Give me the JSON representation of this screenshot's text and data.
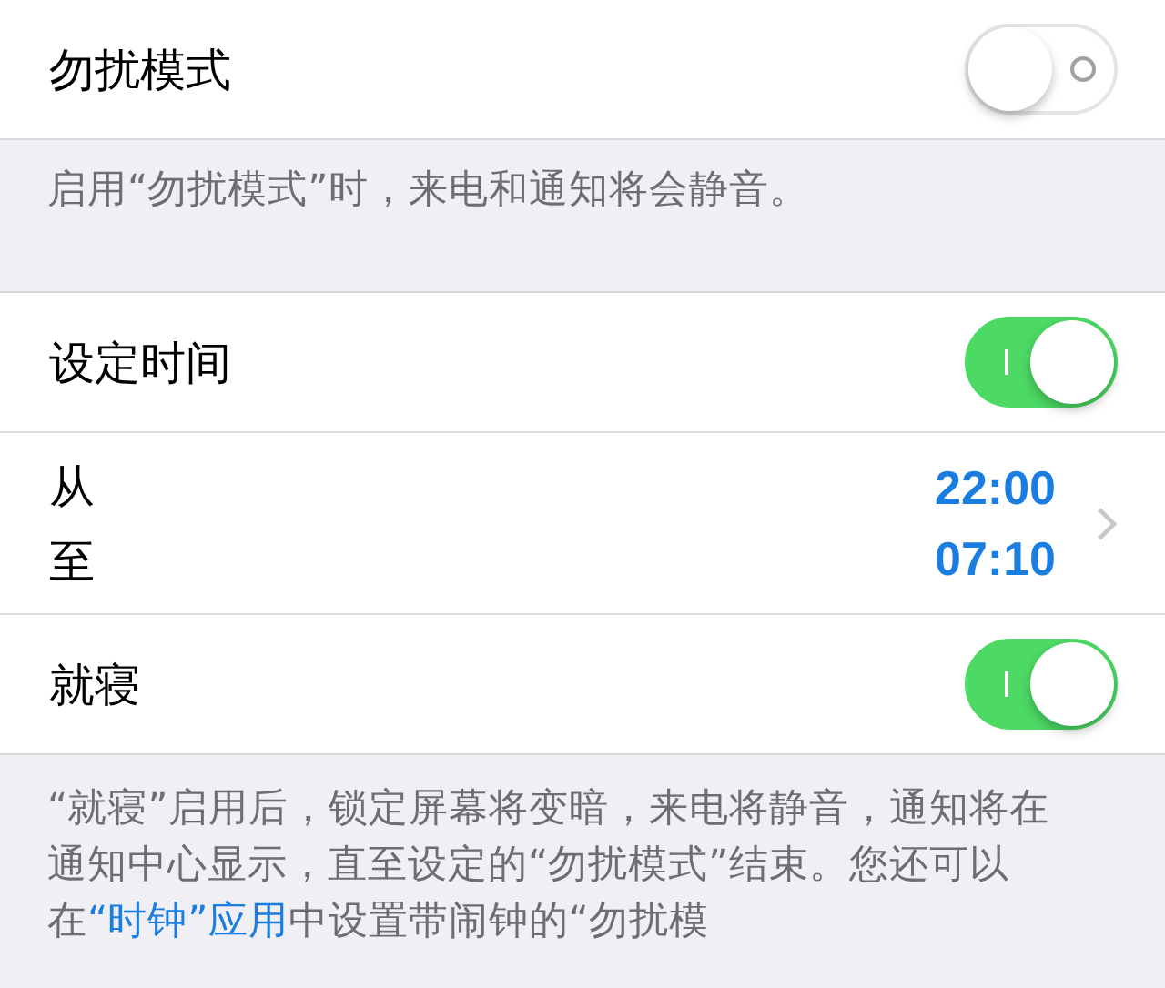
{
  "sections": [
    {
      "rows": [
        {
          "kind": "toggle",
          "label": "勿扰模式",
          "on": false
        }
      ],
      "footer": [
        {
          "kind": "text",
          "text": "启用“勿扰模式”时，来电和通知将会静音。"
        }
      ]
    },
    {
      "rows": [
        {
          "kind": "toggle",
          "label": "设定时间",
          "on": true
        },
        {
          "kind": "schedule",
          "from_label": "从",
          "to_label": "至",
          "from": "22:00",
          "to": "07:10"
        },
        {
          "kind": "toggle",
          "label": "就寝",
          "on": true
        }
      ],
      "footer": [
        {
          "kind": "text",
          "text": "“就寝”启用后，锁定屏幕将变暗，来电将静音，通知将在通知中心显示，直至设定的“勿扰模式”结束。您还可以在"
        },
        {
          "kind": "link",
          "text": "“时钟”应用"
        },
        {
          "kind": "text",
          "text": "中设置带闹钟的“勿扰模"
        }
      ]
    }
  ]
}
